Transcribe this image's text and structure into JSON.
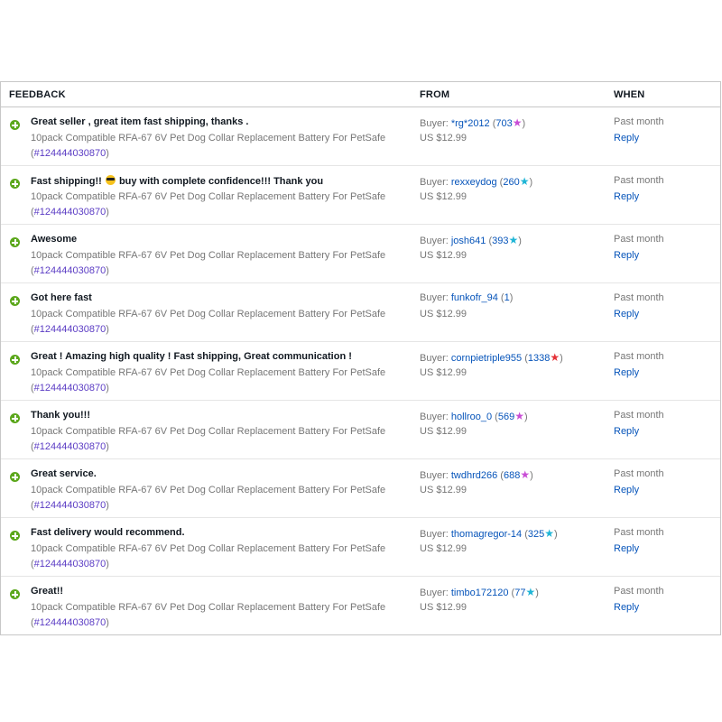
{
  "header": {
    "feedback": "FEEDBACK",
    "from": "FROM",
    "when": "WHEN"
  },
  "colors": {
    "positive_icon": "#5ba71b",
    "link": "#0654ba",
    "item_number": "#5b3cc4",
    "muted": "#767676",
    "star_purple": "#c94dd6",
    "star_turquoise": "#1fb5d6",
    "star_red": "#e53238"
  },
  "rows": [
    {
      "comment_before": "Great seller , great item fast shipping, thanks .",
      "comment_after": "",
      "item_title": "10pack Compatible RFA-67 6V Pet Dog Collar Replacement Battery For PetSafe",
      "item_number": "124444030870",
      "buyer_label": "Buyer: ",
      "buyer_name": "*rg*2012",
      "buyer_score": "703",
      "star_color": "#c94dd6",
      "price": "US $12.99",
      "when": "Past month",
      "reply": "Reply"
    },
    {
      "comment_before": "Fast shipping!! ",
      "comment_after": " buy with complete confidence!!! Thank you",
      "emoji": "sunglasses-emoji",
      "item_title": "10pack Compatible RFA-67 6V Pet Dog Collar Replacement Battery For PetSafe",
      "item_number": "124444030870",
      "buyer_label": "Buyer: ",
      "buyer_name": "rexxeydog",
      "buyer_score": "260",
      "star_color": "#1fb5d6",
      "price": "US $12.99",
      "when": "Past month",
      "reply": "Reply"
    },
    {
      "comment_before": "Awesome",
      "comment_after": "",
      "item_title": "10pack Compatible RFA-67 6V Pet Dog Collar Replacement Battery For PetSafe",
      "item_number": "124444030870",
      "buyer_label": "Buyer: ",
      "buyer_name": "josh641",
      "buyer_score": "393",
      "star_color": "#1fb5d6",
      "price": "US $12.99",
      "when": "Past month",
      "reply": "Reply"
    },
    {
      "comment_before": "Got here fast",
      "comment_after": "",
      "item_title": "10pack Compatible RFA-67 6V Pet Dog Collar Replacement Battery For PetSafe",
      "item_number": "124444030870",
      "buyer_label": "Buyer: ",
      "buyer_name": "funkofr_94",
      "buyer_score": "1",
      "star_color": "",
      "price": "US $12.99",
      "when": "Past month",
      "reply": "Reply"
    },
    {
      "comment_before": "Great ! Amazing high quality ! Fast shipping, Great communication !",
      "comment_after": "",
      "item_title": "10pack Compatible RFA-67 6V Pet Dog Collar Replacement Battery For PetSafe",
      "item_number": "124444030870",
      "buyer_label": "Buyer: ",
      "buyer_name": "cornpietriple955",
      "buyer_score": "1338",
      "star_color": "#e53238",
      "price": "US $12.99",
      "when": "Past month",
      "reply": "Reply"
    },
    {
      "comment_before": "Thank you!!!",
      "comment_after": "",
      "item_title": "10pack Compatible RFA-67 6V Pet Dog Collar Replacement Battery For PetSafe",
      "item_number": "124444030870",
      "buyer_label": "Buyer: ",
      "buyer_name": "hollroo_0",
      "buyer_score": "569",
      "star_color": "#c94dd6",
      "price": "US $12.99",
      "when": "Past month",
      "reply": "Reply"
    },
    {
      "comment_before": "Great service.",
      "comment_after": "",
      "item_title": "10pack Compatible RFA-67 6V Pet Dog Collar Replacement Battery For PetSafe",
      "item_number": "124444030870",
      "buyer_label": "Buyer: ",
      "buyer_name": "twdhrd266",
      "buyer_score": "688",
      "star_color": "#c94dd6",
      "price": "US $12.99",
      "when": "Past month",
      "reply": "Reply"
    },
    {
      "comment_before": "Fast delivery would recommend.",
      "comment_after": "",
      "item_title": "10pack Compatible RFA-67 6V Pet Dog Collar Replacement Battery For PetSafe",
      "item_number": "124444030870",
      "buyer_label": "Buyer: ",
      "buyer_name": "thomagregor-14",
      "buyer_score": "325",
      "star_color": "#1fb5d6",
      "price": "US $12.99",
      "when": "Past month",
      "reply": "Reply"
    },
    {
      "comment_before": "Great!!",
      "comment_after": "",
      "item_title": "10pack Compatible RFA-67 6V Pet Dog Collar Replacement Battery For PetSafe",
      "item_number": "124444030870",
      "buyer_label": "Buyer: ",
      "buyer_name": "timbo172120",
      "buyer_score": "77",
      "star_color": "#1fb5d6",
      "price": "US $12.99",
      "when": "Past month",
      "reply": "Reply"
    }
  ]
}
